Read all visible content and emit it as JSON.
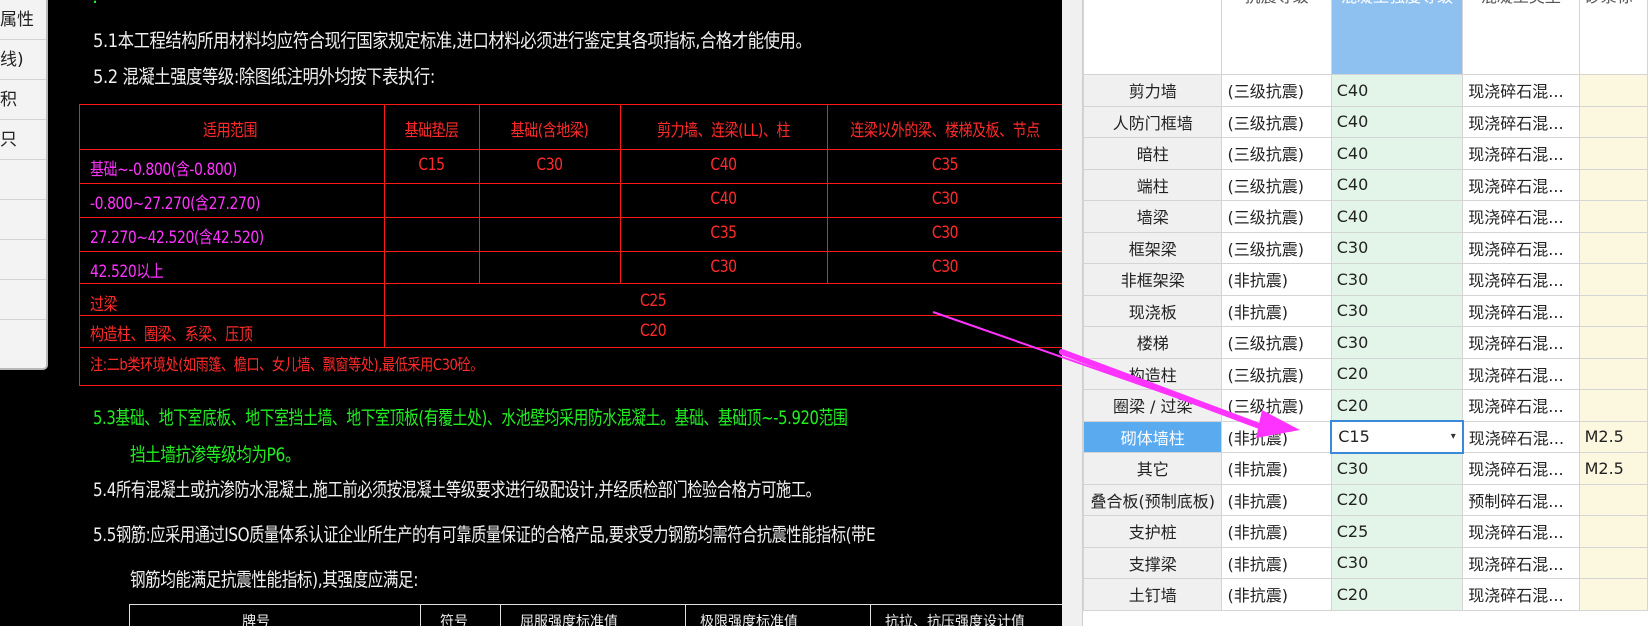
{
  "cad": {
    "lines": {
      "s51": "5.1本工程结构所用材料均应符合现行国家规定标准,进口材料必须进行鉴定其各项指标,合格才能使用。",
      "s52": "5.2 混凝土强度等级:除图纸注明外均按下表执行:",
      "s53a": "5.3基础、地下室底板、地下室挡土墙、地下室顶板(有覆土处)、水池壁均采用防水混凝土。基础、基础顶~-5.920范围",
      "s53b": "挡土墙抗渗等级均为P6。",
      "s54": "5.4所有混凝土或抗渗防水混凝土,施工前必须按混凝土等级要求进行级配设计,并经质检部门检验合格方可施工。",
      "s55a": "5.5钢筋:应采用通过ISO质量体系认证企业所生产的有可靠质量保证的合格产品,要求受力钢筋均需符合抗震性能指标(带E",
      "s55b": "钢筋均能满足抗震性能指标),其强度应满足:"
    },
    "table": {
      "headers": [
        "适用范围",
        "基础垫层",
        "基础(含地梁)",
        "剪力墙、连梁(LL)、柱",
        "连梁以外的梁、楼梯及板、节点"
      ],
      "rows": [
        {
          "range": "基础~-0.800(含-0.800)",
          "c1": "C15",
          "c2": "C30",
          "c3": "C40",
          "c4": "C35"
        },
        {
          "range": "-0.800~27.270(含27.270)",
          "c1": "",
          "c2": "",
          "c3": "C40",
          "c4": "C30"
        },
        {
          "range": "27.270~42.520(含42.520)",
          "c1": "",
          "c2": "",
          "c3": "C35",
          "c4": "C30"
        },
        {
          "range": "42.520以上",
          "c1": "",
          "c2": "",
          "c3": "C30",
          "c4": "C30"
        }
      ],
      "lintel": {
        "label": "过梁",
        "value": "C25"
      },
      "column": {
        "label": "构造柱、圈梁、系梁、压顶",
        "value": "C20"
      },
      "note": "注:二b类环境处(如雨篷、檐口、女儿墙、飘窗等处),最低采用C30砼。"
    },
    "table2_headers": [
      "牌号",
      "符号",
      "屈服强度标准值",
      "极限强度标准值",
      "抗拉、抗压强度设计值"
    ]
  },
  "prop_panel": {
    "items": [
      "属性",
      "线)",
      "积",
      "只",
      "",
      "",
      "",
      "",
      ""
    ]
  },
  "grid": {
    "columns": [
      "抗震等级",
      "混凝土强度等级",
      "混凝土类型",
      "砂浆标"
    ],
    "rows": [
      {
        "name": "剪力墙",
        "seismic": "(三级抗震)",
        "grade": "C40",
        "type": "现浇碎石混...",
        "mortar": ""
      },
      {
        "name": "人防门框墙",
        "seismic": "(三级抗震)",
        "grade": "C40",
        "type": "现浇碎石混...",
        "mortar": ""
      },
      {
        "name": "暗柱",
        "seismic": "(三级抗震)",
        "grade": "C40",
        "type": "现浇碎石混...",
        "mortar": ""
      },
      {
        "name": "端柱",
        "seismic": "(三级抗震)",
        "grade": "C40",
        "type": "现浇碎石混...",
        "mortar": ""
      },
      {
        "name": "墙梁",
        "seismic": "(三级抗震)",
        "grade": "C40",
        "type": "现浇碎石混...",
        "mortar": ""
      },
      {
        "name": "框架梁",
        "seismic": "(三级抗震)",
        "grade": "C30",
        "type": "现浇碎石混...",
        "mortar": ""
      },
      {
        "name": "非框架梁",
        "seismic": "(非抗震)",
        "grade": "C30",
        "type": "现浇碎石混...",
        "mortar": ""
      },
      {
        "name": "现浇板",
        "seismic": "(非抗震)",
        "grade": "C30",
        "type": "现浇碎石混...",
        "mortar": ""
      },
      {
        "name": "楼梯",
        "seismic": "(三级抗震)",
        "grade": "C30",
        "type": "现浇碎石混...",
        "mortar": ""
      },
      {
        "name": "构造柱",
        "seismic": "(三级抗震)",
        "grade": "C20",
        "type": "现浇碎石混...",
        "mortar": ""
      },
      {
        "name": "圈梁 / 过梁",
        "seismic": "(三级抗震)",
        "grade": "C20",
        "type": "现浇碎石混...",
        "mortar": ""
      },
      {
        "name": "砌体墙柱",
        "seismic": "(非抗震)",
        "grade": "C15",
        "type": "现浇碎石混...",
        "mortar": "M2.5"
      },
      {
        "name": "其它",
        "seismic": "(非抗震)",
        "grade": "C30",
        "type": "现浇碎石混...",
        "mortar": "M2.5"
      },
      {
        "name": "叠合板(预制底板)",
        "seismic": "(非抗震)",
        "grade": "C20",
        "type": "预制碎石混...",
        "mortar": ""
      },
      {
        "name": "支护桩",
        "seismic": "(非抗震)",
        "grade": "C25",
        "type": "现浇碎石混...",
        "mortar": ""
      },
      {
        "name": "支撑梁",
        "seismic": "(非抗震)",
        "grade": "C30",
        "type": "现浇碎石混...",
        "mortar": ""
      },
      {
        "name": "土钉墙",
        "seismic": "(非抗震)",
        "grade": "C20",
        "type": "现浇碎石混...",
        "mortar": ""
      }
    ],
    "selected_row": "砌体墙柱",
    "dropdown_caret": "▾"
  },
  "colors": {
    "cad_red": "#ff2a2a",
    "cad_magenta": "#ff33ff",
    "cad_green": "#22ee22",
    "arrow": "#ff33ff",
    "selected_header": "#5aaaf0",
    "grade_bg": "#e3f5e8"
  }
}
